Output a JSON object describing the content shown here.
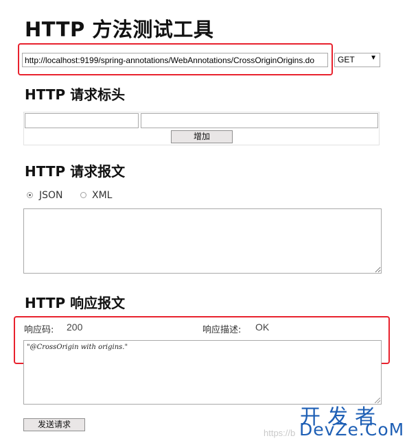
{
  "title": "HTTP 方法测试工具",
  "request": {
    "url": "http://localhost:9199/spring-annotations/WebAnnotations/CrossOriginOrigins.do",
    "method": "GET",
    "method_arrow": "▼"
  },
  "headers_section": {
    "title": "HTTP 请求标头",
    "key_value": "",
    "value_value": "",
    "add_button": "增加"
  },
  "body_section": {
    "title": "HTTP 请求报文",
    "format_options": [
      {
        "label": "JSON",
        "checked": true
      },
      {
        "label": "XML",
        "checked": false
      }
    ],
    "body_text": ""
  },
  "response_section": {
    "title": "HTTP 响应报文",
    "code_label": "响应码:",
    "code_value": "200",
    "desc_label": "响应描述:",
    "desc_value": "OK",
    "body_text": "\"@CrossOrigin with origins.\""
  },
  "send_button": "发送请求",
  "watermark": {
    "cn": "开发者",
    "en": "DevZe.CoM",
    "faint": "https://b"
  },
  "colors": {
    "highlight_border": "#e8212d",
    "watermark": "#1e5fb5",
    "button_bg": "#e9e6e6"
  }
}
